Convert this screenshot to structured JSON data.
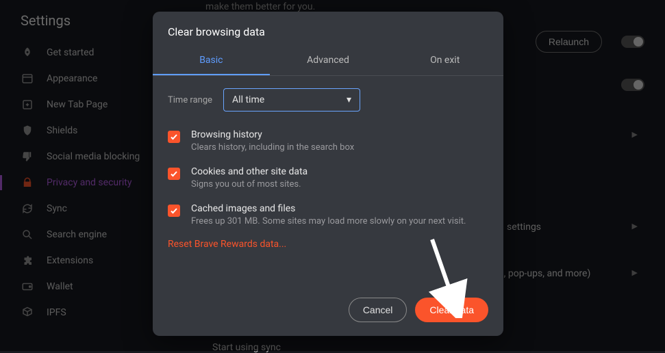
{
  "settings_title": "Settings",
  "sidebar": {
    "items": [
      {
        "label": "Get started",
        "icon": "rocket"
      },
      {
        "label": "Appearance",
        "icon": "layout"
      },
      {
        "label": "New Tab Page",
        "icon": "plus-box"
      },
      {
        "label": "Shields",
        "icon": "shield"
      },
      {
        "label": "Social media blocking",
        "icon": "thumb-down"
      },
      {
        "label": "Privacy and security",
        "icon": "lock",
        "active": true
      },
      {
        "label": "Sync",
        "icon": "sync"
      },
      {
        "label": "Search engine",
        "icon": "search"
      },
      {
        "label": "Extensions",
        "icon": "puzzle"
      },
      {
        "label": "Wallet",
        "icon": "wallet"
      },
      {
        "label": "IPFS",
        "icon": "cube"
      }
    ]
  },
  "main": {
    "top_text": "make them better for you.",
    "relaunch": "Relaunch",
    "section_settings": "settings",
    "section_popups": "a, pop-ups, and more)",
    "sync_start": "Start using sync"
  },
  "modal": {
    "title": "Clear browsing data",
    "tabs": [
      {
        "label": "Basic",
        "active": true
      },
      {
        "label": "Advanced"
      },
      {
        "label": "On exit"
      }
    ],
    "time_range_label": "Time range",
    "time_range_value": "All time",
    "options": [
      {
        "title": "Browsing history",
        "sub": "Clears history, including in the search box",
        "checked": true
      },
      {
        "title": "Cookies and other site data",
        "sub": "Signs you out of most sites.",
        "checked": true
      },
      {
        "title": "Cached images and files",
        "sub": "Frees up 301 MB. Some sites may load more slowly on your next visit.",
        "checked": true
      }
    ],
    "reset_link": "Reset Brave Rewards data...",
    "cancel": "Cancel",
    "clear": "Clear data"
  }
}
